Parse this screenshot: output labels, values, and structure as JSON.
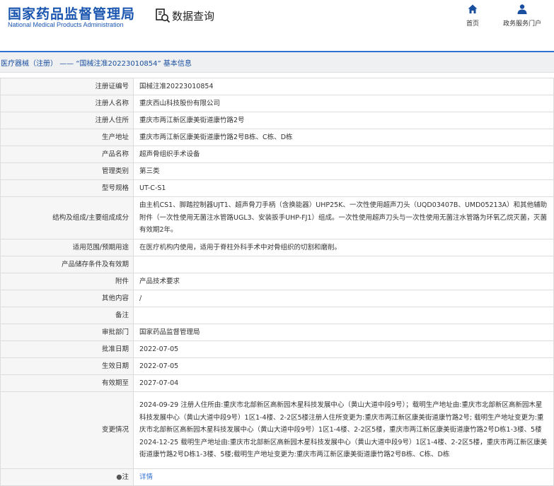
{
  "header": {
    "logo_cn": "国家药品监督管理局",
    "logo_en": "National Medical Products Administration",
    "query_label": "数据查询",
    "nav": [
      {
        "label": "首页",
        "icon": "home-icon"
      },
      {
        "label": "政务服务门户",
        "icon": "user-icon"
      }
    ]
  },
  "breadcrumb": "医疗器械（注册） —— “国械注准20223010854” 基本信息",
  "rows": [
    {
      "label": "注册证编号",
      "value": "国械注准20223010854"
    },
    {
      "label": "注册人名称",
      "value": "重庆西山科技股份有限公司"
    },
    {
      "label": "注册人住所",
      "value": "重庆市两江新区康美街道康竹路2号"
    },
    {
      "label": "生产地址",
      "value": "重庆市两江新区康美街道康竹路2号B栋、C栋、D栋"
    },
    {
      "label": "产品名称",
      "value": "超声骨组织手术设备"
    },
    {
      "label": "管理类别",
      "value": "第三类"
    },
    {
      "label": "型号规格",
      "value": "UT-C-S1"
    },
    {
      "label": "结构及组成/主要组成成分",
      "value": "由主机CS1、脚踏控制器UJT1、超声骨刀手柄（含换能器）UHP25K、一次性使用超声刀头（UQD03407B、UMD05213A）和其他辅助附件（一次性使用无菌注水管路UGL3、安装扳手UHP-FJ1）组成。一次性使用超声刀头与一次性使用无菌注水管路为环氧乙烷灭菌，灭菌有效期2年。"
    },
    {
      "label": "适用范围/预期用途",
      "value": "在医疗机构内使用，适用于脊柱外科手术中对骨组织的切割和磨削。"
    },
    {
      "label": "产品储存条件及有效期",
      "value": ""
    },
    {
      "label": "附件",
      "value": "产品技术要求"
    },
    {
      "label": "其他内容",
      "value": "/"
    },
    {
      "label": "备注",
      "value": ""
    },
    {
      "label": "审批部门",
      "value": "国家药品监督管理局"
    },
    {
      "label": "批准日期",
      "value": "2022-07-05"
    },
    {
      "label": "生效日期",
      "value": "2022-07-05"
    },
    {
      "label": "有效期至",
      "value": "2027-07-04"
    },
    {
      "label": "变更情况",
      "value": "2024-09-29 注册人住所由:重庆市北部新区高新园木星科技发展中心（黄山大道中段9号）；载明生产地址由:重庆市北部新区高新园木星科技发展中心（黄山大道中段9号）1区1-4楼、2-2区5楼注册人住所变更为:重庆市两江新区康美街道康竹路2号; 载明生产地址变更为:重庆市北部新区高新园木星科技发展中心（黄山大道中段9号）1区1-4楼、2-2区5楼，重庆市两江新区康美街道康竹路2号D栋1-3楼、5楼 2024-12-25 载明生产地址由:重庆市北部新区高新园木星科技发展中心（黄山大道中段9号）1区1-4楼、2-2区5楼，重庆市两江新区康美街道康竹路2号D栋1-3楼、5楼;载明生产地址变更为:重庆市两江新区康美街道康竹路2号B栋、C栋、D栋"
    },
    {
      "label": "注",
      "value": "详情"
    }
  ],
  "change_log": [
    "2024-09-29 注册人住所由:重庆市北部新区高新园木星科技发展中心（黄山大道中段9号）；载明生产地址由:重庆市北部新区高新园木星科技发展中心（黄山大道中段9号）1区1-4楼、2-2区5楼注册人住所变更为:重庆市两江新区康美街道康竹路2号; 载明生产地址变更为:重庆市北部新区高新园木星科技发展中心（黄山大道中段9号）1区1-4楼、2-2区5楼，重庆市两江新区康美街道康竹路2号D栋1-3楼、5楼",
    "2024-12-25 载明生产地址由:重庆市北部新区高新园木星科技发展中心（黄山大道中段9号）1区1-4楼、2-2区5楼，重庆市两江新区康美街道康竹路2号D栋1-3楼、5楼;载明生产地址变更为:重庆市两江新区康美街道康竹路2号B栋、C栋、D栋"
  ],
  "colors": {
    "brand": "#1a56b0",
    "accent": "#2f6fd0",
    "label_bg": "#f6f6f6",
    "border": "#dcdcdc"
  }
}
